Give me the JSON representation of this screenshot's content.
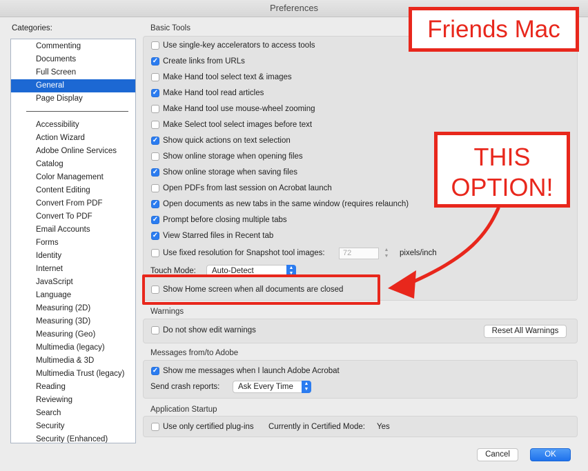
{
  "window": {
    "title": "Preferences"
  },
  "categories": {
    "label": "Categories:",
    "top_items": [
      "Commenting",
      "Documents",
      "Full Screen",
      "General",
      "Page Display"
    ],
    "selected": "General",
    "items": [
      "Accessibility",
      "Action Wizard",
      "Adobe Online Services",
      "Catalog",
      "Color Management",
      "Content Editing",
      "Convert From PDF",
      "Convert To PDF",
      "Email Accounts",
      "Forms",
      "Identity",
      "Internet",
      "JavaScript",
      "Language",
      "Measuring (2D)",
      "Measuring (3D)",
      "Measuring (Geo)",
      "Multimedia (legacy)",
      "Multimedia & 3D",
      "Multimedia Trust (legacy)",
      "Reading",
      "Reviewing",
      "Search",
      "Security",
      "Security (Enhanced)"
    ]
  },
  "basic_tools": {
    "title": "Basic Tools",
    "options": [
      {
        "label": "Use single-key accelerators to access tools",
        "checked": false
      },
      {
        "label": "Create links from URLs",
        "checked": true
      },
      {
        "label": "Make Hand tool select text & images",
        "checked": false
      },
      {
        "label": "Make Hand tool read articles",
        "checked": true
      },
      {
        "label": "Make Hand tool use mouse-wheel zooming",
        "checked": false
      },
      {
        "label": "Make Select tool select images before text",
        "checked": false
      },
      {
        "label": "Show quick actions on text selection",
        "checked": true
      },
      {
        "label": "Show online storage when opening files",
        "checked": false
      },
      {
        "label": "Show online storage when saving files",
        "checked": true
      },
      {
        "label": "Open PDFs from last session on Acrobat launch",
        "checked": false
      },
      {
        "label": "Open documents as new tabs in the same window (requires relaunch)",
        "checked": true
      },
      {
        "label": "Prompt before closing multiple tabs",
        "checked": true
      },
      {
        "label": "View Starred files in Recent tab",
        "checked": true
      },
      {
        "label": "Use fixed resolution for Snapshot tool images:",
        "checked": false
      }
    ],
    "snapshot_resolution": "72",
    "snapshot_unit": "pixels/inch",
    "touch_mode_label": "Touch Mode:",
    "touch_mode_value": "Auto-Detect",
    "home_screen": {
      "label": "Show Home screen when all documents are closed",
      "checked": false
    }
  },
  "warnings": {
    "title": "Warnings",
    "option": {
      "label": "Do not show edit warnings",
      "checked": false
    },
    "reset_label": "Reset All Warnings"
  },
  "messages": {
    "title": "Messages from/to Adobe",
    "option": {
      "label": "Show me messages when I launch Adobe Acrobat",
      "checked": true
    },
    "crash_label": "Send crash reports:",
    "crash_value": "Ask Every Time"
  },
  "startup": {
    "title": "Application Startup",
    "option": {
      "label": "Use only certified plug-ins",
      "checked": false
    },
    "certified_mode_label": "Currently in Certified Mode:",
    "certified_mode_value": "Yes"
  },
  "buttons": {
    "cancel": "Cancel",
    "ok": "OK"
  },
  "annotations": {
    "brand": "Friends Mac",
    "callout_line1": "THIS",
    "callout_line2": "OPTION!",
    "color": "#e8271c"
  },
  "colors": {
    "accent": "#2b7cf0",
    "selection": "#1c68d3"
  }
}
